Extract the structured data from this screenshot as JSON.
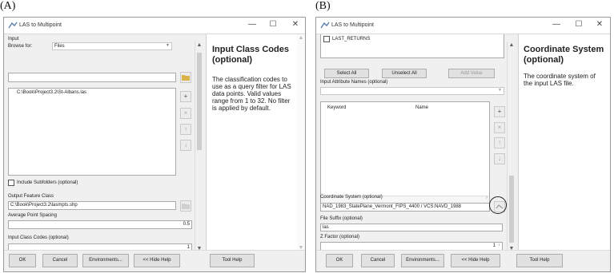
{
  "panel_a": {
    "label": "(A)",
    "window_title": "LAS to Multipoint",
    "input_label": "Input",
    "browse_label": "Browse for:",
    "browse_value": "Files",
    "input_item": "C:\\Book\\Project3.2\\St-Albans.las",
    "include_subfolders": "Include Subfolders (optional)",
    "output_label": "Output Feature Class",
    "output_value": "C:\\Book\\Project3.2\\lasmpts.shp",
    "spacing_label": "Average Point Spacing",
    "spacing_value": "0.5",
    "class_label": "Input Class Codes (optional)",
    "class_value": "1",
    "help_title": "Input Class Codes (optional)",
    "help_text": "The classification codes to use as a query filter for LAS data points. Valid values range from 1 to 32. No filter is applied by default.",
    "buttons": {
      "ok": "OK",
      "cancel": "Cancel",
      "env": "Environments...",
      "hide": "<< Hide Help",
      "tool": "Tool Help"
    }
  },
  "panel_b": {
    "label": "(B)",
    "window_title": "LAS to Multipoint",
    "last_returns": "LAST_RETURNS",
    "select_all": "Select All",
    "unselect_all": "Unselect All",
    "add_value": "Add Value",
    "attr_label": "Input Attribute Names (optional)",
    "col_keyword": "Keyword",
    "col_name": "Name",
    "coord_label": "Coordinate System (optional)",
    "coord_value": "NAD_1983_StatePlane_Vermont_FIPS_4400 / VCS:NAVD_1988",
    "suffix_label": "File Suffix (optional)",
    "suffix_value": "las",
    "zfactor_label": "Z Factor (optional)",
    "zfactor_value": "1",
    "help_title": "Coordinate System (optional)",
    "help_text": "The coordinate system of the input LAS file.",
    "buttons": {
      "ok": "OK",
      "cancel": "Cancel",
      "env": "Environments...",
      "hide": "<< Hide Help",
      "tool": "Tool Help"
    }
  },
  "icons": {
    "minimize": "—",
    "maximize": "☐",
    "close": "✕",
    "add": "+",
    "remove": "×",
    "up": "↑",
    "down": "↓",
    "up_arrow": "▲",
    "down_arrow": "▼",
    "folder": "📂"
  }
}
